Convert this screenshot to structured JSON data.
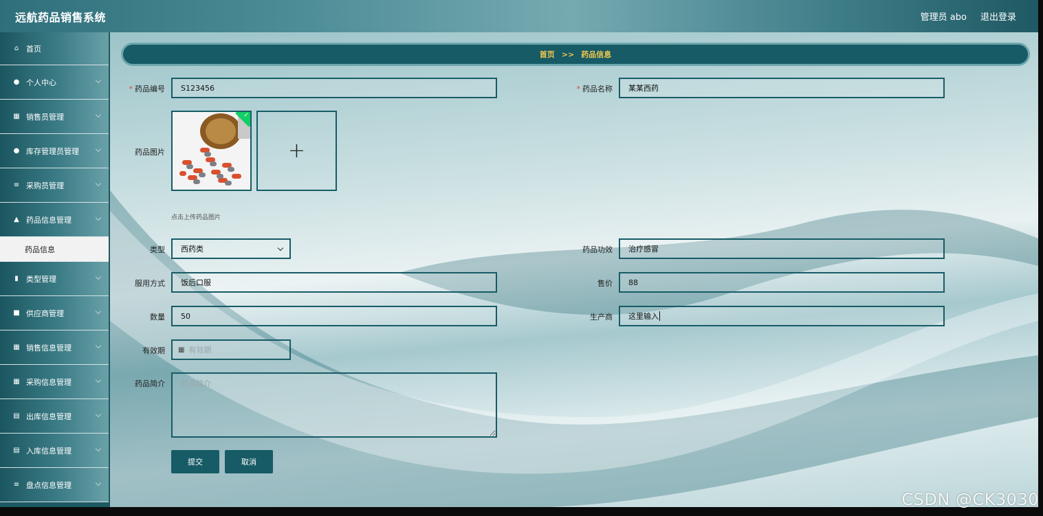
{
  "header": {
    "app_title": "远航药品销售系统",
    "user_label": "管理员 abo",
    "logout_label": "退出登录"
  },
  "sidebar": {
    "items": [
      {
        "label": "首页",
        "icon": "home-icon"
      },
      {
        "label": "个人中心",
        "icon": "user-icon"
      },
      {
        "label": "销售员管理",
        "icon": "grid-icon"
      },
      {
        "label": "库存管理员管理",
        "icon": "location-icon"
      },
      {
        "label": "采购员管理",
        "icon": "list-icon"
      },
      {
        "label": "药品信息管理",
        "icon": "thumb-icon"
      },
      {
        "label": "类型管理",
        "icon": "bar-chart-icon"
      },
      {
        "label": "供应商管理",
        "icon": "briefcase-icon"
      },
      {
        "label": "销售信息管理",
        "icon": "grid-icon"
      },
      {
        "label": "采购信息管理",
        "icon": "grid-icon"
      },
      {
        "label": "出库信息管理",
        "icon": "clipboard-icon"
      },
      {
        "label": "入库信息管理",
        "icon": "clipboard-icon"
      },
      {
        "label": "盘点信息管理",
        "icon": "list-icon"
      }
    ],
    "sub_item": "药品信息"
  },
  "breadcrumb": {
    "home": "首页",
    "separator": ">>",
    "current": "药品信息"
  },
  "form": {
    "code_label": "药品编号",
    "code_value": "S123456",
    "name_label": "药品名称",
    "name_value": "某某西药",
    "image_label": "药品图片",
    "image_hint": "点击上传药品图片",
    "type_label": "类型",
    "type_value": "西药类",
    "effect_label": "药品功效",
    "effect_value": "治疗感冒",
    "usage_label": "服用方式",
    "usage_value": "饭后口服",
    "price_label": "售价",
    "price_value": "88",
    "qty_label": "数量",
    "qty_value": "50",
    "maker_label": "生产商",
    "maker_value": "这里输入",
    "expiry_label": "有效期",
    "expiry_placeholder": "有效期",
    "intro_label": "药品简介",
    "intro_placeholder": "药品简介",
    "submit_label": "提交",
    "cancel_label": "取消"
  },
  "watermark": "CSDN @CK3030",
  "colors": {
    "primary": "#175b66",
    "breadcrumb_text": "#f2c84b",
    "required": "#e0443e",
    "success": "#13ce66"
  }
}
